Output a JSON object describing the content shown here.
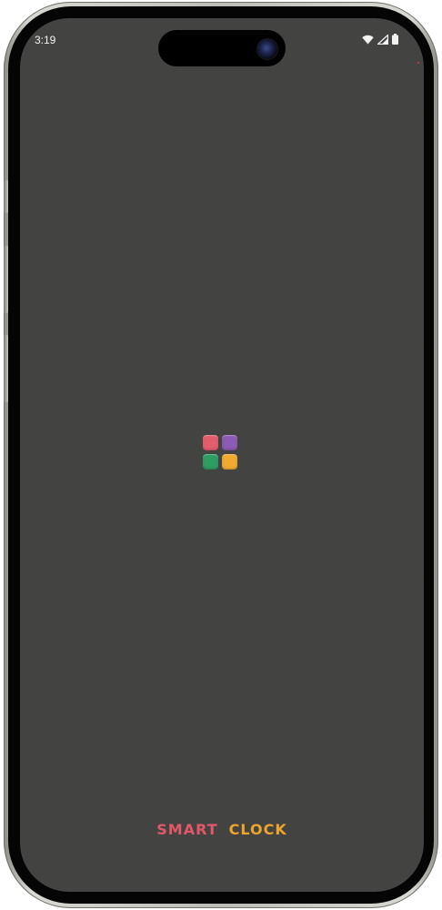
{
  "status_bar": {
    "time": "3:19",
    "icons": [
      "wifi-icon",
      "cellular-signal-icon",
      "battery-icon"
    ]
  },
  "splash": {
    "logo": {
      "icon": "app-grid-logo-icon",
      "tile_colors": [
        "#e35d6d",
        "#8c5bb3",
        "#2e9d61",
        "#efaa2f"
      ]
    },
    "brand": {
      "word1": "SMART",
      "word2": "CLOCK",
      "word1_color": "#e35868",
      "word2_color": "#eda52c"
    }
  },
  "colors": {
    "screen_background": "#434342"
  }
}
